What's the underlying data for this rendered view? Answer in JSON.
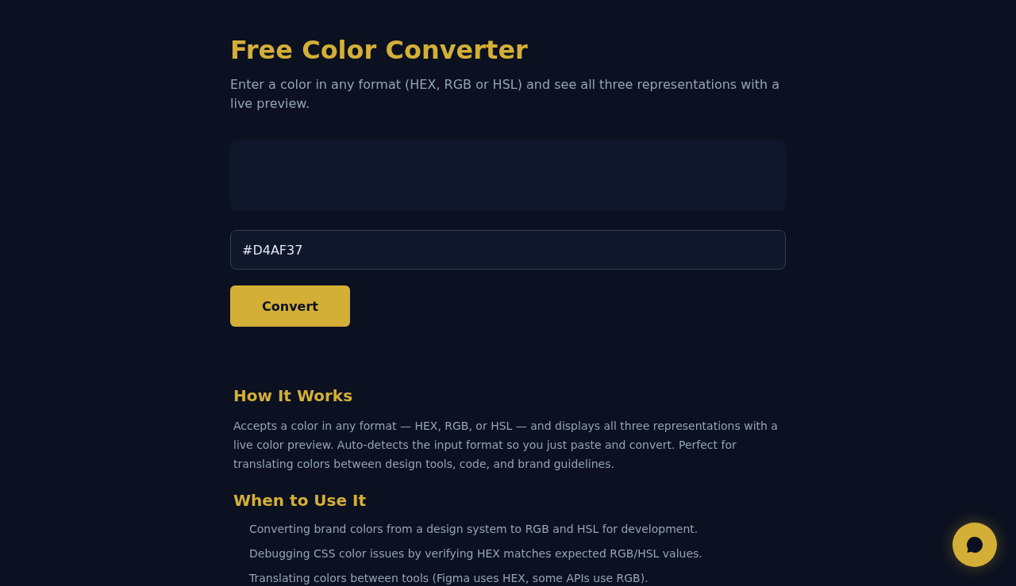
{
  "header": {
    "title": "Free Color Converter",
    "subtitle": "Enter a color in any format (HEX, RGB or HSL) and see all three representations with a live preview."
  },
  "converter": {
    "input": {
      "value": "#D4AF37"
    },
    "button": "Convert"
  },
  "sections": [
    {
      "kind": "paragraph",
      "heading": "How It Works",
      "body": "Accepts a color in any format — HEX, RGB, or HSL — and displays all three representations with a live color preview. Auto-detects the input format so you just paste and convert. Perfect for translating colors between design tools, code, and brand guidelines."
    },
    {
      "kind": "list",
      "heading": "When to Use It",
      "items": [
        "Converting brand colors from a design system to RGB and HSL for development.",
        "Debugging CSS color issues by verifying HEX matches expected RGB/HSL values.",
        "Translating colors between tools (Figma uses HEX, some APIs use RGB)."
      ]
    }
  ]
}
